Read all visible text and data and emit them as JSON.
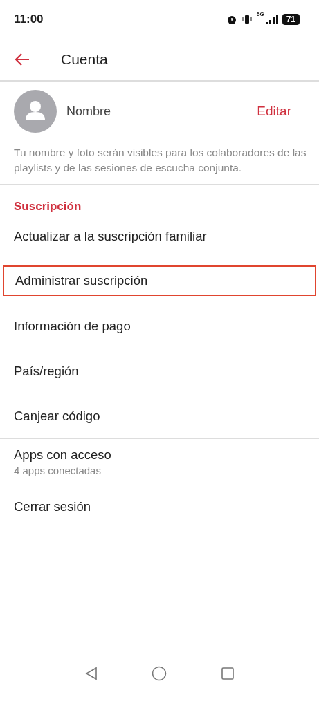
{
  "status_bar": {
    "time": "11:00",
    "network": "5G",
    "battery": "71"
  },
  "header": {
    "title": "Cuenta"
  },
  "profile": {
    "name": "Nombre",
    "action": "Editar",
    "note": "Tu nombre y foto serán visibles para los colaboradores de las playlists y de las sesiones de escucha conjunta."
  },
  "sections": [
    {
      "title": "Suscripción",
      "items": [
        {
          "label": "Actualizar a la suscripción familiar",
          "highlighted": false
        },
        {
          "label": "Administrar suscripción",
          "highlighted": true
        },
        {
          "label": "Información de pago",
          "highlighted": false
        },
        {
          "label": "País/región",
          "highlighted": false
        },
        {
          "label": "Canjear código",
          "highlighted": false
        }
      ]
    },
    {
      "items": [
        {
          "label": "Apps con acceso",
          "subtitle": "4 apps conectadas",
          "highlighted": false
        },
        {
          "label": "Cerrar sesión",
          "highlighted": false
        }
      ]
    }
  ]
}
